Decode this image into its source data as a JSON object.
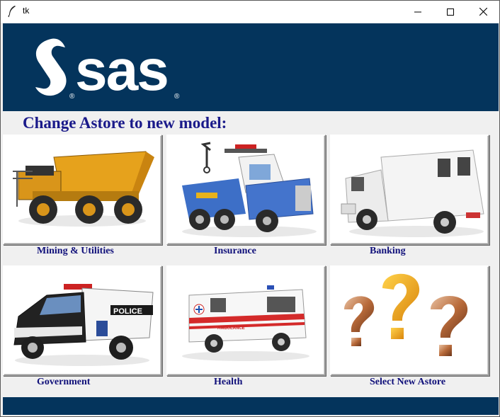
{
  "window": {
    "title": "tk",
    "controls": {
      "minimize": "minimize",
      "maximize": "maximize",
      "close": "close"
    }
  },
  "banner": {
    "logo_text": "sas",
    "registered_mark": "®",
    "color": "#04345c"
  },
  "heading": "Change Astore to new model:",
  "tiles": [
    {
      "label": "Mining & Utilities",
      "icon": "mining-dump-truck"
    },
    {
      "label": "Insurance",
      "icon": "tow-truck"
    },
    {
      "label": "Banking",
      "icon": "armored-truck"
    },
    {
      "label": "Government",
      "icon": "police-truck"
    },
    {
      "label": "Health",
      "icon": "ambulance"
    },
    {
      "label": "Select New Astore",
      "icon": "question-marks"
    }
  ],
  "colors": {
    "heading": "#1a1a8a",
    "label": "#10107a",
    "banner": "#04345c",
    "background": "#f0f0f0"
  }
}
